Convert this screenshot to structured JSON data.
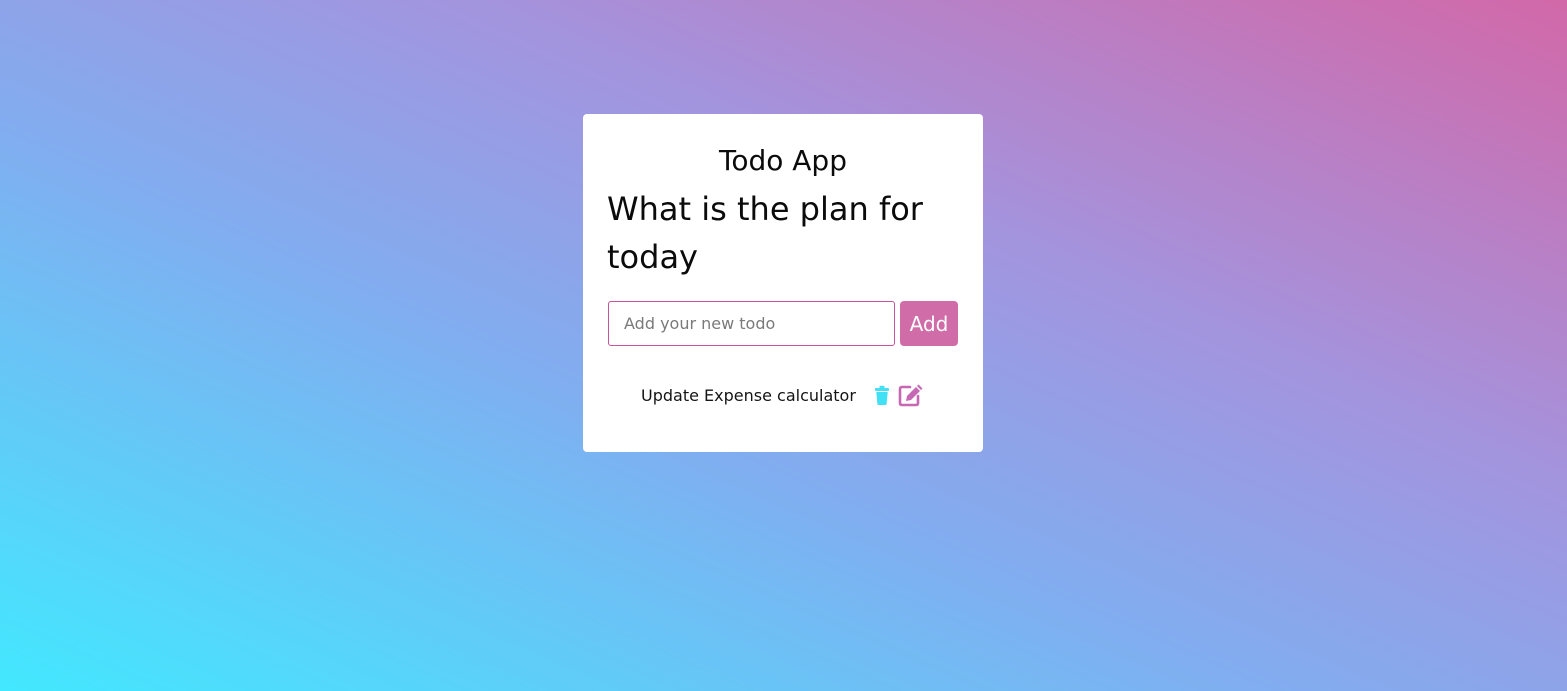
{
  "app": {
    "title": "Todo App",
    "heading": "What is the plan for today"
  },
  "form": {
    "placeholder": "Add your new todo",
    "value": "",
    "add_label": "Add"
  },
  "todos": [
    {
      "text": "Update Expense calculator",
      "delete_icon": "trash-icon",
      "edit_icon": "edit-icon"
    }
  ],
  "colors": {
    "accent": "#d06da8",
    "delete_icon": "#42e0f5",
    "edit_icon": "#c768b4",
    "card_bg": "#ffffff"
  }
}
